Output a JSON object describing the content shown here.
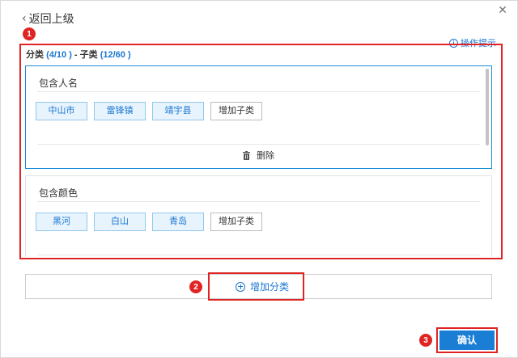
{
  "header": {
    "back_label": "返回上级",
    "hint_label": "操作提示"
  },
  "summary": {
    "category_label": "分类",
    "category_count": "(4/10 )",
    "separator": " - ",
    "sub_label": "子类",
    "sub_count": "(12/60 )"
  },
  "groups": [
    {
      "title": "包含人名",
      "tags": [
        "中山市",
        "雷锋镇",
        "靖宇县"
      ],
      "add_label": "增加子类",
      "delete_label": "删除"
    },
    {
      "title": "包含颜色",
      "tags": [
        "黑河",
        "白山",
        "青岛"
      ],
      "add_label": "增加子类"
    }
  ],
  "add_category_label": "增加分类",
  "confirm_label": "确认",
  "markers": [
    "1",
    "2",
    "3"
  ],
  "colors": {
    "accent": "#1976d2",
    "highlight": "#e02424",
    "button": "#1a7fd4"
  }
}
